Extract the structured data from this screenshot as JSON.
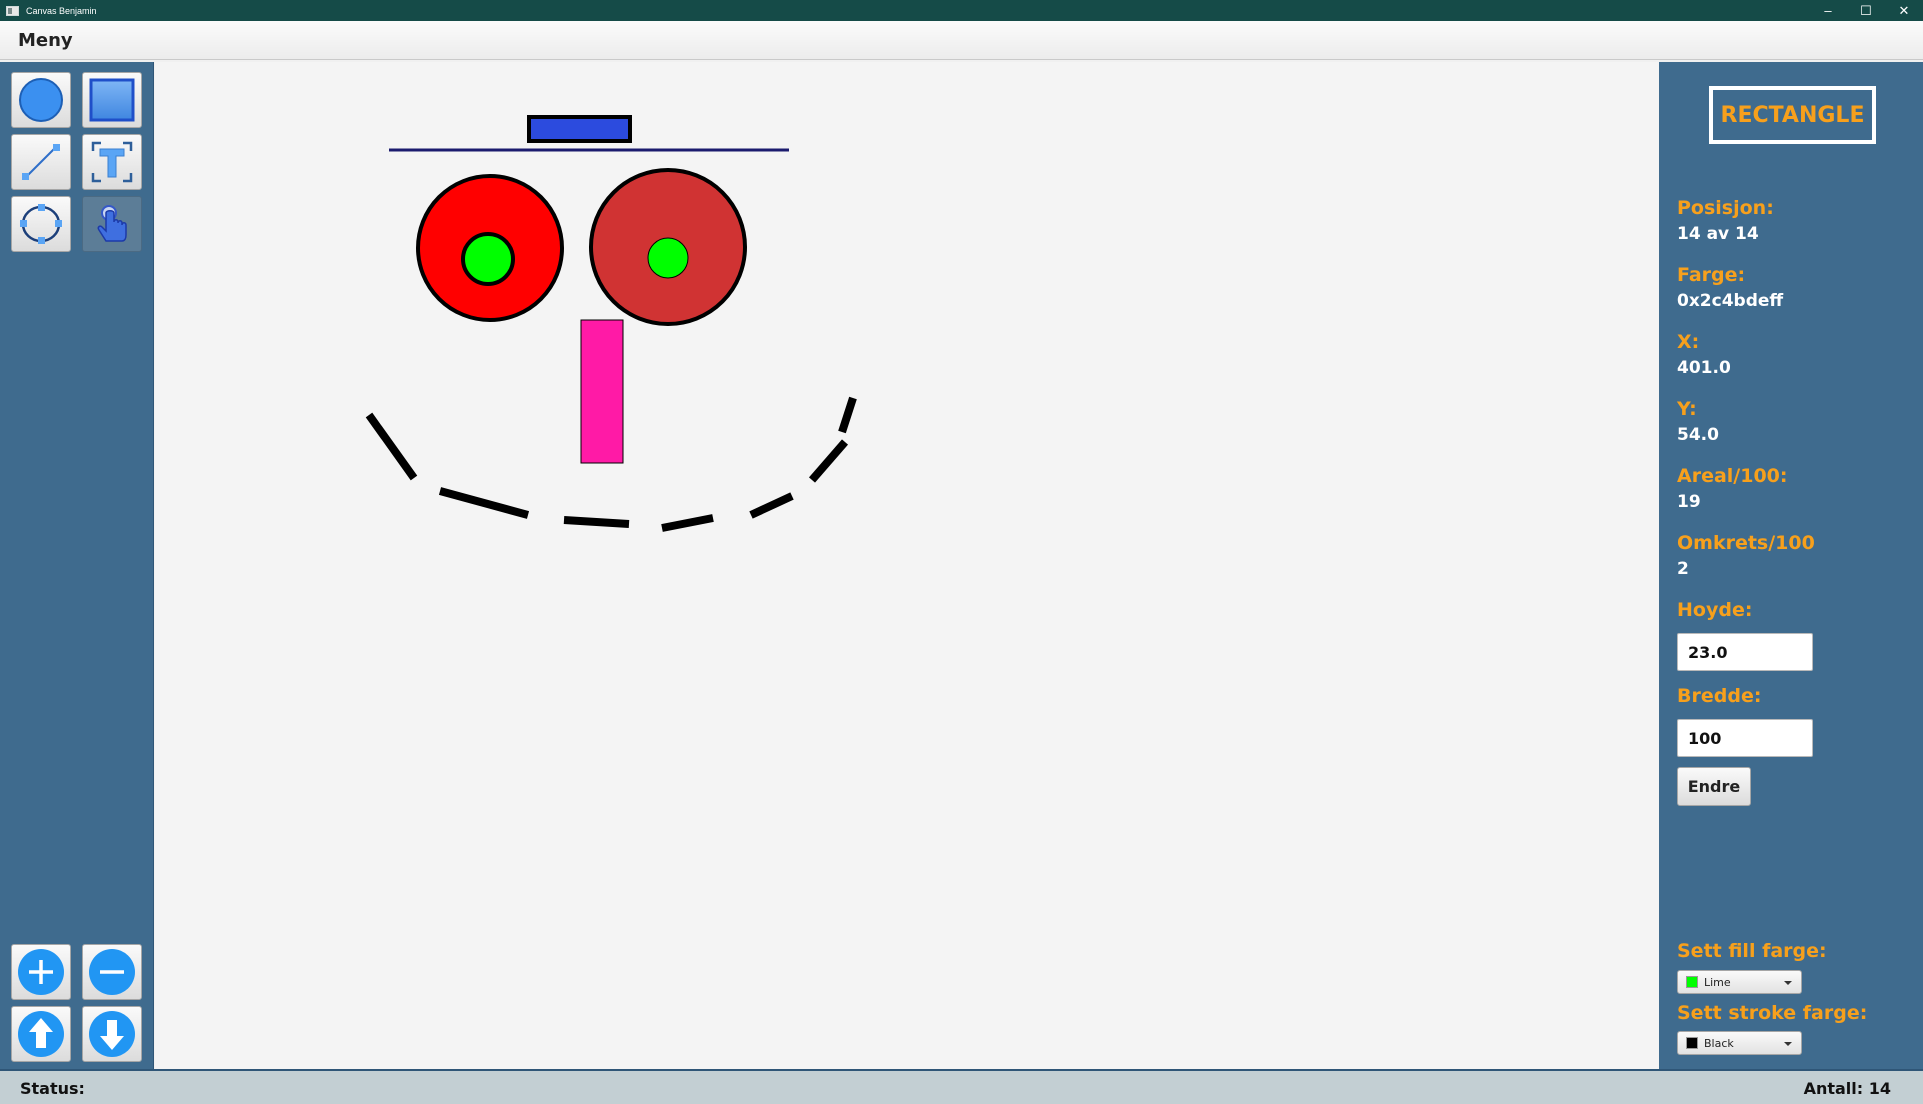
{
  "window": {
    "title": "Canvas Benjamin",
    "controls": [
      "–",
      "☐",
      "✕"
    ]
  },
  "menubar": {
    "menu_label": "Meny"
  },
  "toolbar": {
    "tools": [
      "circle-tool",
      "rectangle-tool",
      "line-tool",
      "text-tool",
      "ellipse-tool",
      "select-tool"
    ],
    "selected_tool": "select-tool",
    "actions": [
      "zoom-in",
      "zoom-out",
      "move-up",
      "move-down"
    ]
  },
  "properties": {
    "shape_type": "RECTANGLE",
    "position_label": "Posisjon:",
    "position_value": "14 av 14",
    "color_label": "Farge:",
    "color_value": "0x2c4bdeff",
    "x_label": "X:",
    "x_value": "401.0",
    "y_label": "Y:",
    "y_value": "54.0",
    "area_label": "Areal/100:",
    "area_value": "19",
    "perimeter_label": "Omkrets/100",
    "perimeter_value": "2",
    "height_label": "Hoyde:",
    "height_value": "23.0",
    "width_label": "Bredde:",
    "width_value": "100",
    "apply_label": "Endre",
    "fill_label": "Sett fill farge:",
    "fill_value": "Lime",
    "fill_color": "#00ff00",
    "stroke_label": "Sett stroke farge:",
    "stroke_value": "Black",
    "stroke_color": "#000000"
  },
  "status": {
    "status_label": "Status:",
    "count_label": "Antall: 14"
  },
  "colors": {
    "panel": "#3f6b8e",
    "accent": "#f7a01c",
    "selected_shape": "#2c4bde",
    "left_eye": "#ff0000",
    "right_eye": "#d03333",
    "pupil": "#00ff00",
    "nose": "#ff1aa6"
  }
}
